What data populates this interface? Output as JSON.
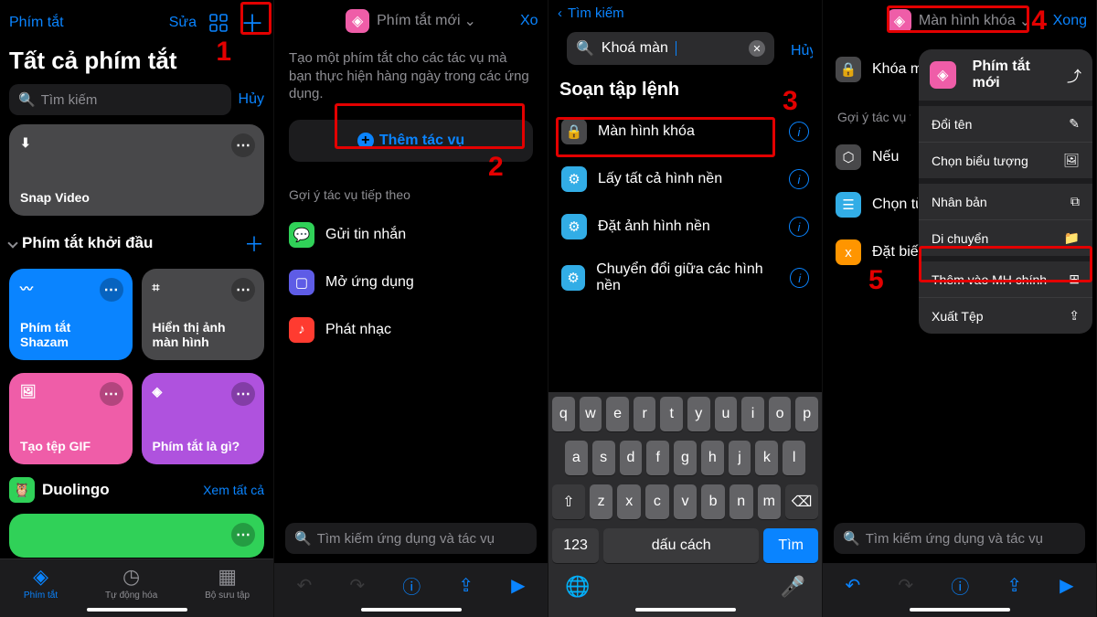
{
  "panel1": {
    "topLeft": "Phím tắt",
    "edit": "Sửa",
    "title": "Tất cả phím tắt",
    "searchPlaceholder": "Tìm kiếm",
    "cancel": "Hủy",
    "tile1": "Snap Video",
    "sectionStarter": "Phím tắt khởi đầu",
    "tileShazam": "Phím tắt Shazam",
    "tileScreenshot": "Hiển thị ảnh màn hình",
    "tileGif": "Tạo tệp GIF",
    "tileWhat": "Phím tắt là gì?",
    "duolingo": "Duolingo",
    "seeAll": "Xem tất cả",
    "tabs": {
      "shortcuts": "Phím tắt",
      "automation": "Tự động hóa",
      "gallery": "Bộ sưu tập"
    }
  },
  "panel2": {
    "title": "Phím tắt mới",
    "done": "Xong",
    "desc": "Tạo một phím tắt cho các tác vụ mà bạn thực hiện hàng ngày trong các ứng dụng.",
    "addAction": "Thêm tác vụ",
    "suggestTitle": "Gợi ý tác vụ tiếp theo",
    "suggest1": "Gửi tin nhắn",
    "suggest2": "Mở ứng dụng",
    "suggest3": "Phát nhạc",
    "searchPlaceholder": "Tìm kiếm ứng dụng và tác vụ"
  },
  "panel3": {
    "back": "Tìm kiếm",
    "searchValue": "Khoá màn",
    "cancel": "Hủy",
    "sectionTitle": "Soạn tập lệnh",
    "r1": "Màn hình khóa",
    "r2": "Lấy tất cả hình nền",
    "r3": "Đặt ảnh hình nền",
    "r4": "Chuyển đổi giữa các hình nền",
    "keys": {
      "row1": [
        "q",
        "w",
        "e",
        "r",
        "t",
        "y",
        "u",
        "i",
        "o",
        "p"
      ],
      "row2": [
        "a",
        "s",
        "d",
        "f",
        "g",
        "h",
        "j",
        "k",
        "l"
      ],
      "row3": [
        "z",
        "x",
        "c",
        "v",
        "b",
        "n",
        "m"
      ],
      "num": "123",
      "space": "dấu cách",
      "search": "Tìm"
    }
  },
  "panel4": {
    "topTitle": "Màn hình khóa",
    "done": "Xong",
    "menuTitle": "Phím tắt mới",
    "m1": "Đổi tên",
    "m2": "Chọn biểu tượng",
    "m3": "Nhân bản",
    "m4": "Di chuyển",
    "m5": "Thêm vào MH chính",
    "m6": "Xuất Tệp",
    "bodyR1": "Khóa màn hình",
    "hintTitle": "Gợi ý tác vụ tiếp theo",
    "bodyR2": "Nếu",
    "bodyR3": "Chọn từ menu",
    "bodyR4": "Đặt biến",
    "searchPlaceholder": "Tìm kiếm ứng dụng và tác vụ"
  },
  "annotations": {
    "n1": "1",
    "n2": "2",
    "n3": "3",
    "n4": "4",
    "n5": "5"
  }
}
